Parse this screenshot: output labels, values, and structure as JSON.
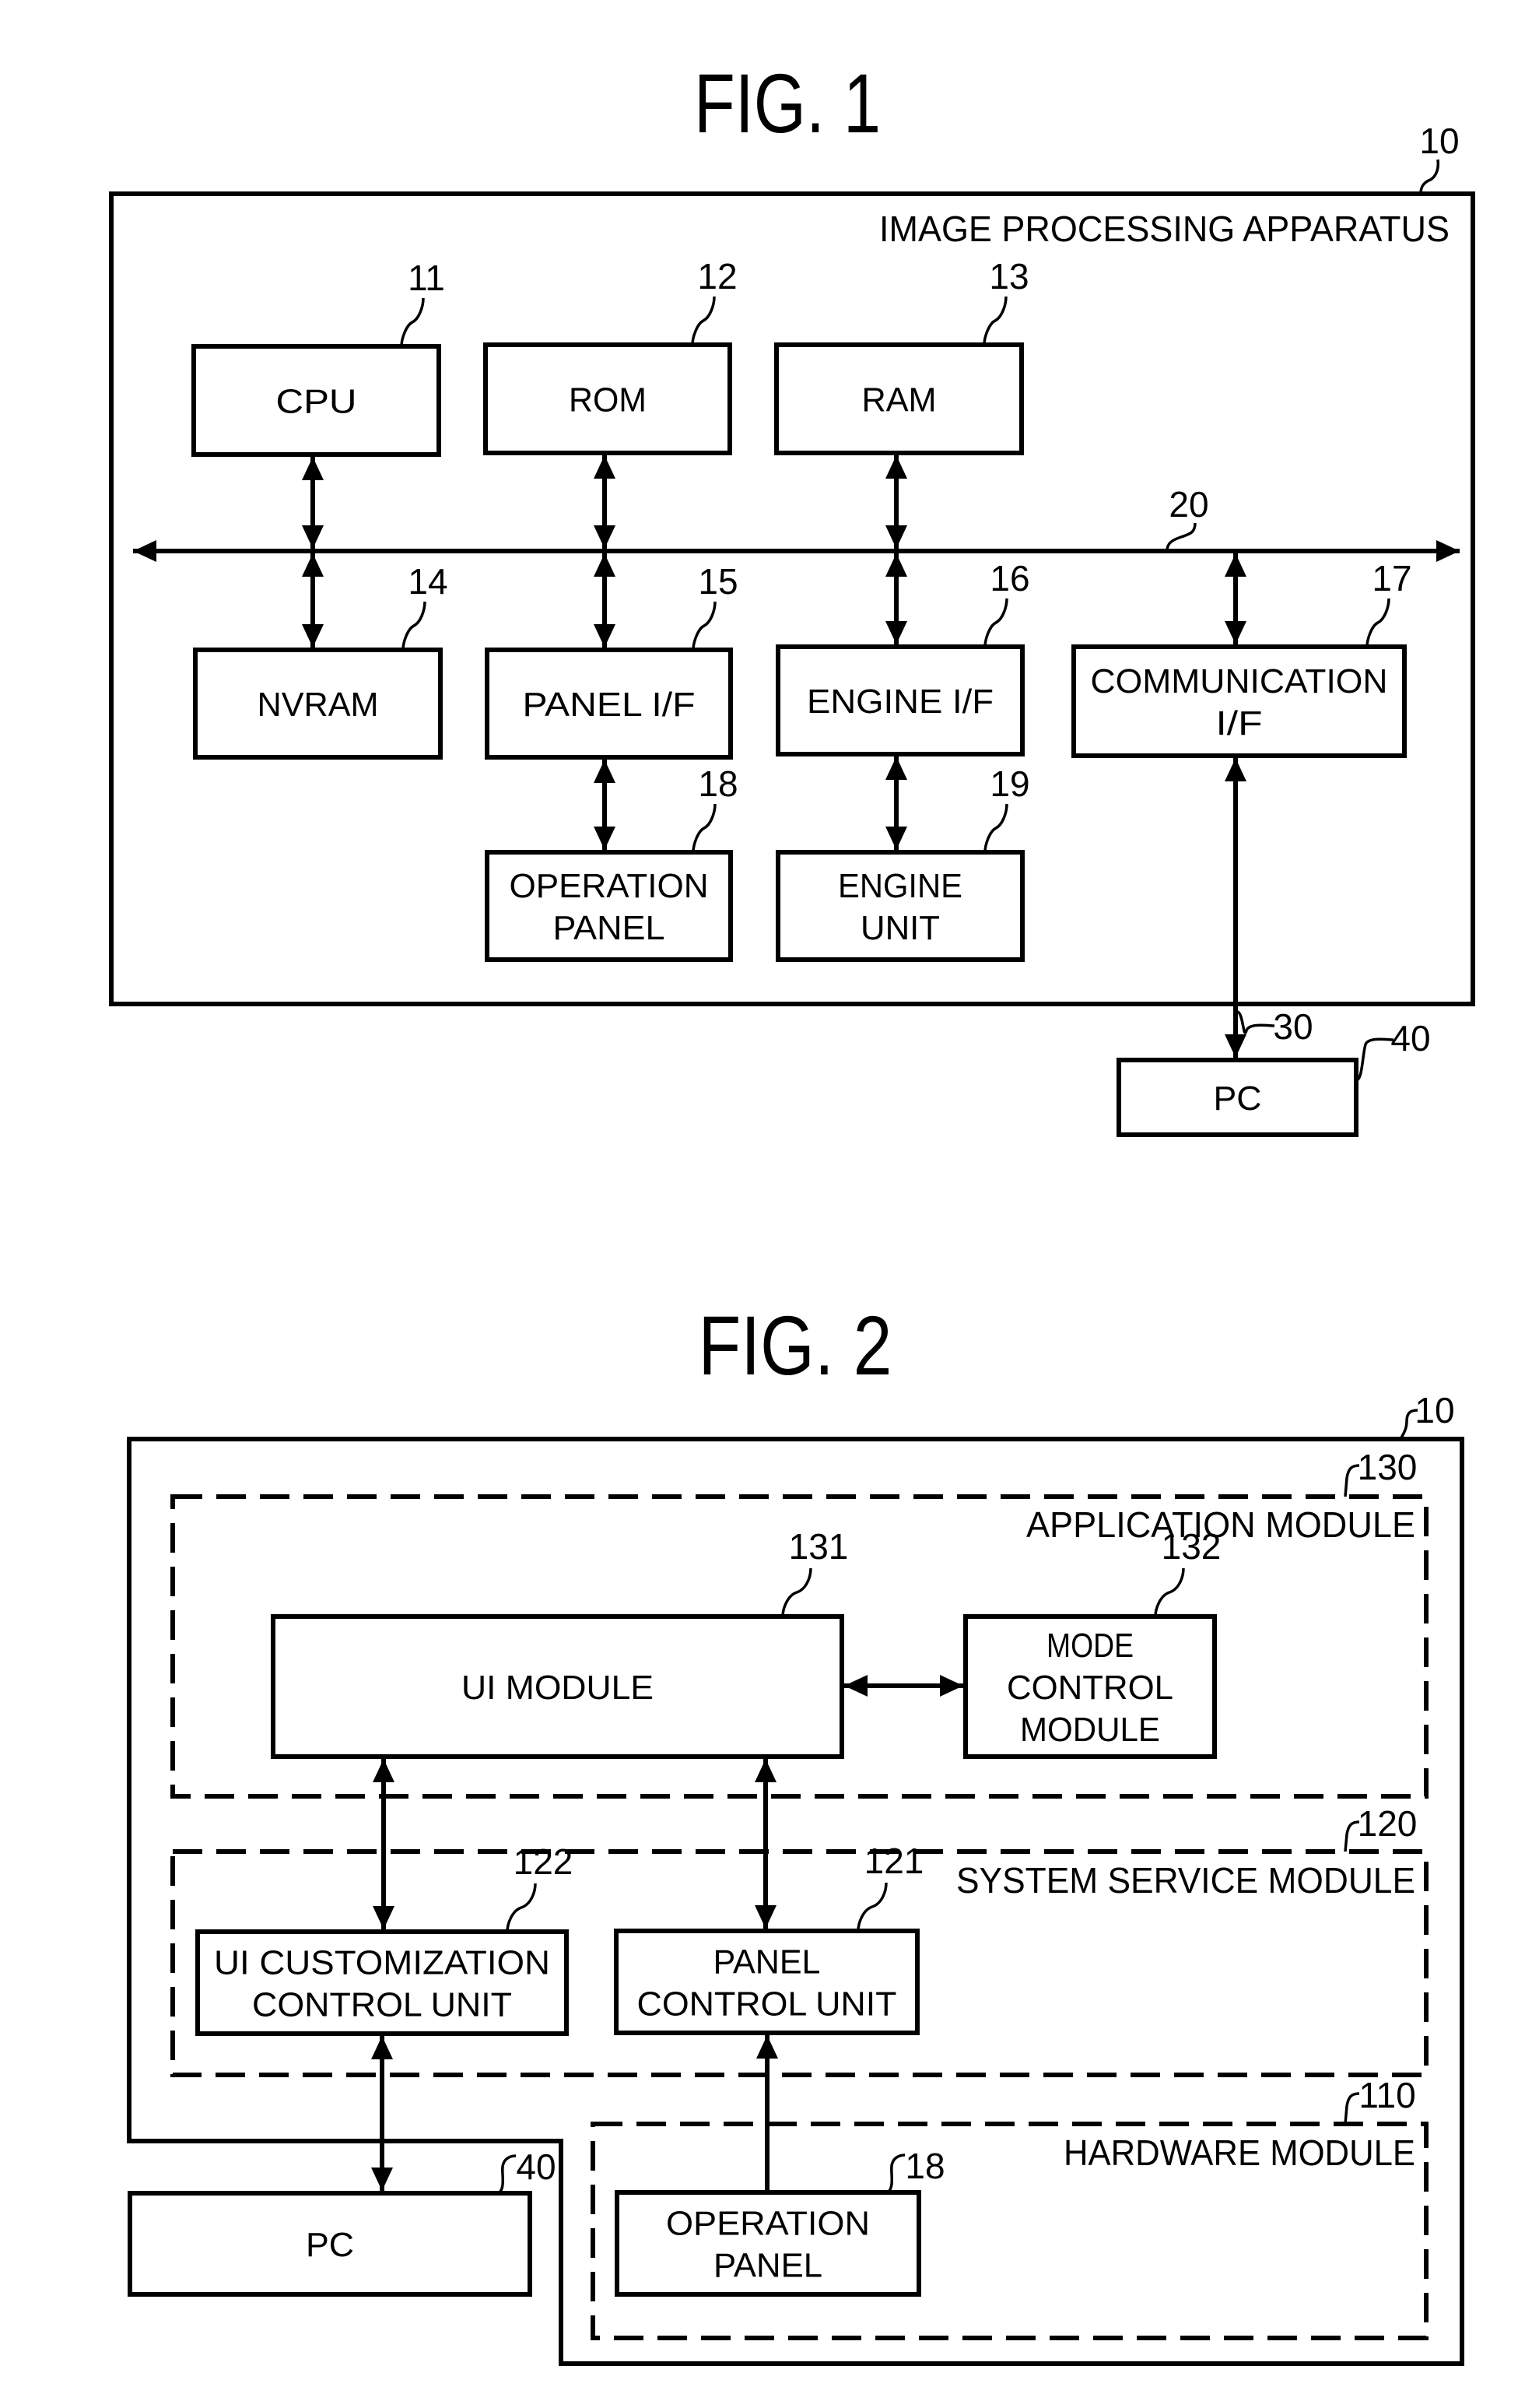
{
  "fig1": {
    "title": "FIG. 1",
    "apparatus": {
      "ref": "10",
      "label": "IMAGE PROCESSING APPARATUS"
    },
    "bus": {
      "ref": "20"
    },
    "line_to_pc": {
      "ref": "30"
    },
    "blocks": [
      {
        "id": "cpu",
        "ref": "11",
        "lines": [
          "CPU"
        ]
      },
      {
        "id": "rom",
        "ref": "12",
        "lines": [
          "ROM"
        ]
      },
      {
        "id": "ram",
        "ref": "13",
        "lines": [
          "RAM"
        ]
      },
      {
        "id": "nvram",
        "ref": "14",
        "lines": [
          "NVRAM"
        ]
      },
      {
        "id": "panel-if",
        "ref": "15",
        "lines": [
          "PANEL I/F"
        ]
      },
      {
        "id": "engine-if",
        "ref": "16",
        "lines": [
          "ENGINE I/F"
        ]
      },
      {
        "id": "communication-if",
        "ref": "17",
        "lines": [
          "COMMUNICATION",
          "I/F"
        ]
      },
      {
        "id": "operation-panel",
        "ref": "18",
        "lines": [
          "OPERATION",
          "PANEL"
        ]
      },
      {
        "id": "engine-unit",
        "ref": "19",
        "lines": [
          "ENGINE",
          "UNIT"
        ]
      },
      {
        "id": "pc",
        "ref": "40",
        "lines": [
          "PC"
        ]
      }
    ],
    "connections": [
      {
        "from": "cpu",
        "to": "bus",
        "arrows": "both"
      },
      {
        "from": "rom",
        "to": "bus",
        "arrows": "both"
      },
      {
        "from": "ram",
        "to": "bus",
        "arrows": "both"
      },
      {
        "from": "bus",
        "to": "nvram",
        "arrows": "both"
      },
      {
        "from": "bus",
        "to": "panel-if",
        "arrows": "both"
      },
      {
        "from": "bus",
        "to": "engine-if",
        "arrows": "both"
      },
      {
        "from": "bus",
        "to": "communication-if",
        "arrows": "both"
      },
      {
        "from": "panel-if",
        "to": "operation-panel",
        "arrows": "both"
      },
      {
        "from": "engine-if",
        "to": "engine-unit",
        "arrows": "both"
      },
      {
        "from": "communication-if",
        "to": "pc",
        "arrows": "both"
      }
    ]
  },
  "fig2": {
    "title": "FIG. 2",
    "apparatus": {
      "ref": "10"
    },
    "groups": [
      {
        "id": "application-module",
        "ref": "130",
        "label": "APPLICATION MODULE"
      },
      {
        "id": "system-service-module",
        "ref": "120",
        "label": "SYSTEM SERVICE MODULE"
      },
      {
        "id": "hardware-module",
        "ref": "110",
        "label": "HARDWARE MODULE"
      }
    ],
    "blocks": [
      {
        "id": "ui-module",
        "ref": "131",
        "lines": [
          "UI MODULE"
        ]
      },
      {
        "id": "mode-control-module",
        "ref": "132",
        "lines": [
          "MODE",
          "CONTROL",
          "MODULE"
        ]
      },
      {
        "id": "ui-customization-control-unit",
        "ref": "122",
        "lines": [
          "UI CUSTOMIZATION",
          "CONTROL UNIT"
        ]
      },
      {
        "id": "panel-control-unit",
        "ref": "121",
        "lines": [
          "PANEL",
          "CONTROL UNIT"
        ]
      },
      {
        "id": "operation-panel",
        "ref": "18",
        "lines": [
          "OPERATION",
          "PANEL"
        ]
      },
      {
        "id": "pc",
        "ref": "40",
        "lines": [
          "PC"
        ]
      }
    ],
    "connections": [
      {
        "from": "ui-module",
        "to": "mode-control-module",
        "arrows": "both"
      },
      {
        "from": "ui-module",
        "to": "ui-customization-control-unit",
        "arrows": "both"
      },
      {
        "from": "ui-module",
        "to": "panel-control-unit",
        "arrows": "both"
      },
      {
        "from": "ui-customization-control-unit",
        "to": "pc",
        "arrows": "both"
      },
      {
        "from": "operation-panel",
        "to": "panel-control-unit",
        "arrows": "to"
      }
    ]
  }
}
